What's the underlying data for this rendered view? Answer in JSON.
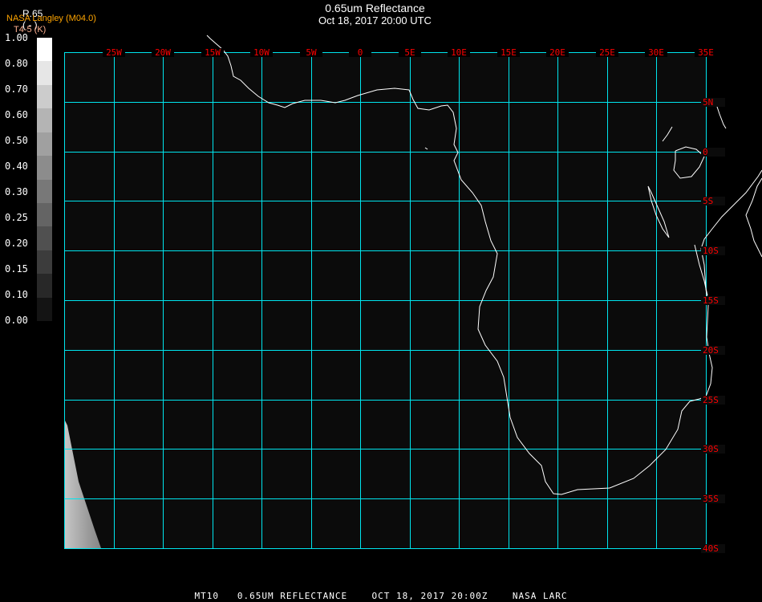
{
  "header": {
    "title": "0.65um Reflectance",
    "subtitle": "Oct 18, 2017 20:00 UTC"
  },
  "legend": {
    "producer": "NASA Langley (M04.0)",
    "variable": "R.65",
    "units": "( - )",
    "overlay_variable": "T4-5 (K)",
    "labels": [
      "1.00",
      "0.80",
      "0.70",
      "0.60",
      "0.50",
      "0.40",
      "0.30",
      "0.25",
      "0.20",
      "0.15",
      "0.10",
      "0.00"
    ],
    "colors": [
      "#ffffff",
      "#e6e6e6",
      "#cccccc",
      "#b4b4b4",
      "#a0a0a0",
      "#8c8c8c",
      "#787878",
      "#646464",
      "#505050",
      "#3c3c3c",
      "#282828",
      "#141414"
    ]
  },
  "map": {
    "lon_labels": [
      "25W",
      "20W",
      "15W",
      "10W",
      "5W",
      "0",
      "5E",
      "10E",
      "15E",
      "20E",
      "25E",
      "30E",
      "35E"
    ],
    "lat_labels": [
      "5N",
      "0",
      "5S",
      "10S",
      "15S",
      "20S",
      "25S",
      "30S",
      "35S",
      "40S"
    ],
    "grid_color": "#00e5ee",
    "label_color": "#ff0000",
    "coast_color": "#ffffff"
  },
  "footer": "MT10   0.65UM REFLECTANCE    OCT 18, 2017 20:00Z    NASA LARC"
}
